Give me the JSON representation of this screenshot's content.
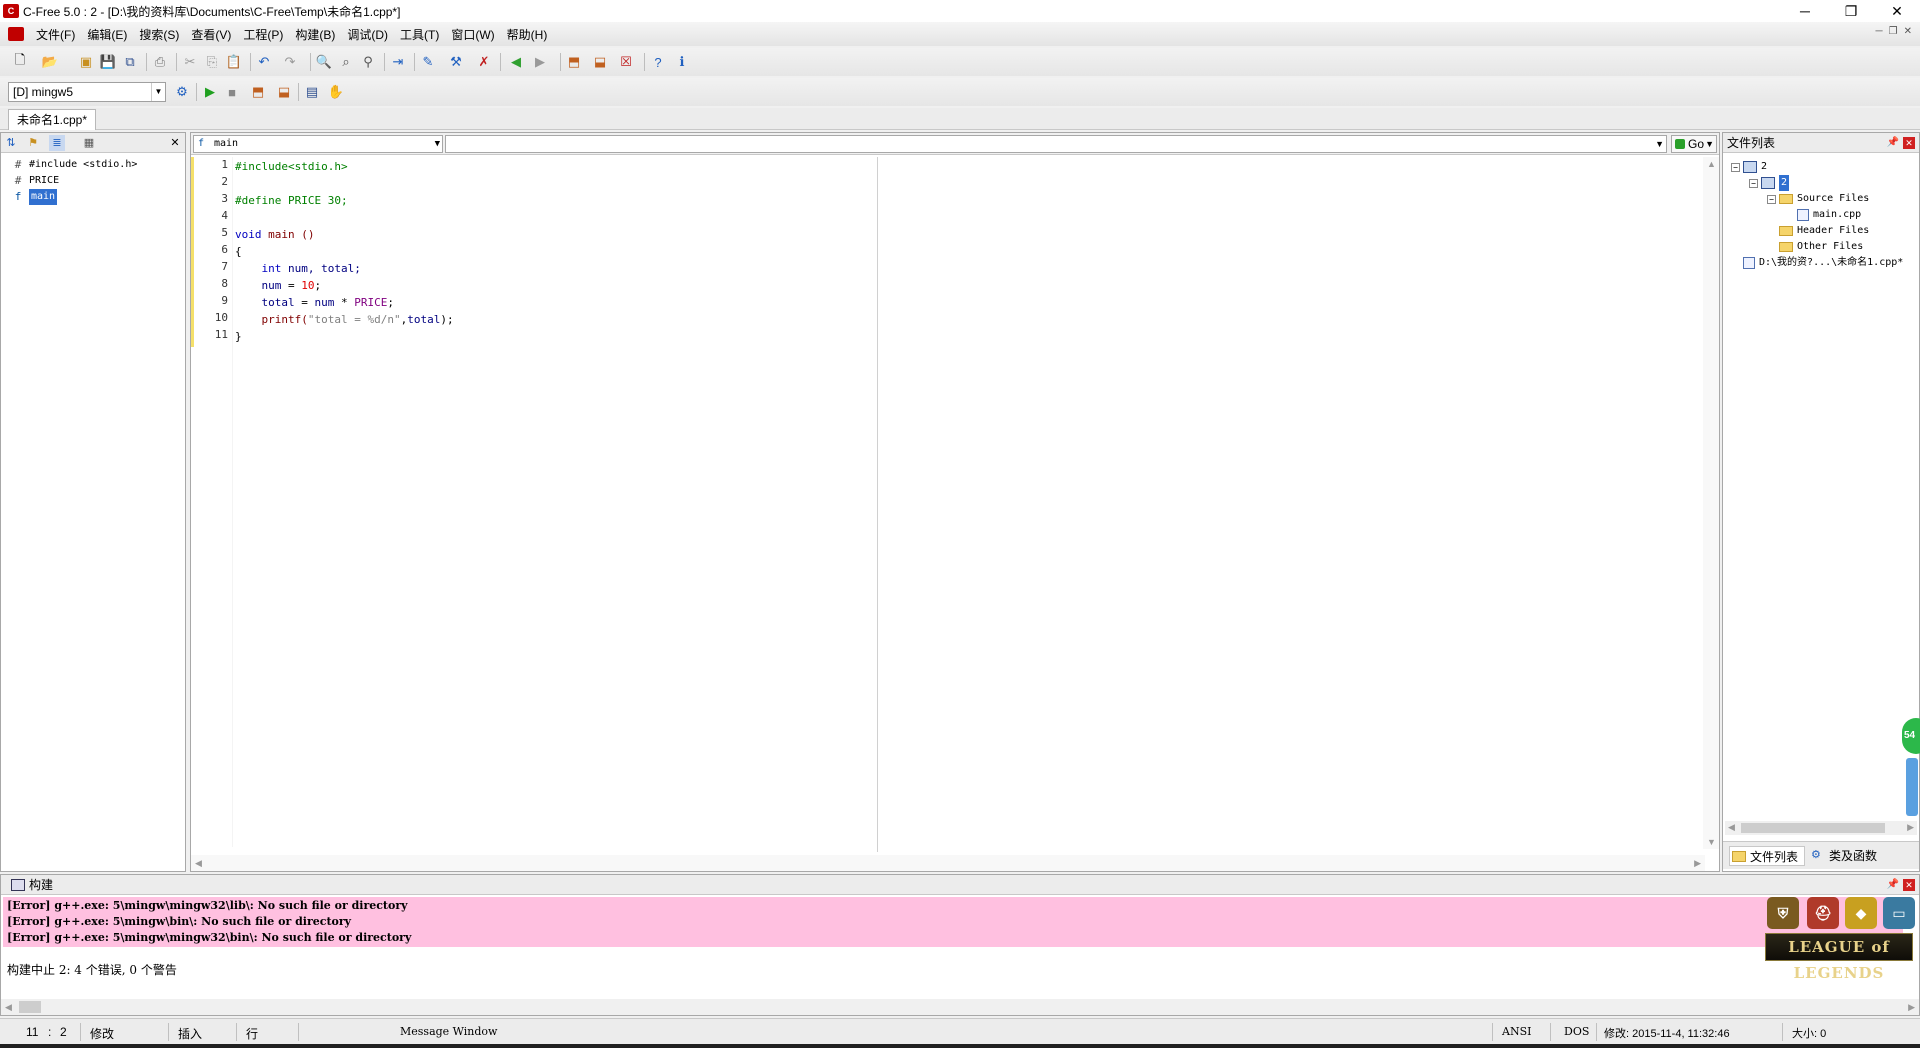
{
  "window": {
    "title": "C-Free 5.0 : 2 - [D:\\我的资料库\\Documents\\C-Free\\Temp\\未命名1.cpp*]",
    "app_icon": "cfree-app-icon",
    "controls": [
      "─",
      "❐",
      "✕"
    ]
  },
  "menu": {
    "items": [
      "文件(F)",
      "编辑(E)",
      "搜索(S)",
      "查看(V)",
      "工程(P)",
      "构建(B)",
      "调试(D)",
      "工具(T)",
      "窗口(W)",
      "帮助(H)"
    ]
  },
  "mdi_controls": [
    "─",
    "❐",
    "✕"
  ],
  "toolbar": {
    "compiler": "[D] mingw5",
    "icons": [
      "new-file-icon",
      "open-icon",
      "open-project-icon",
      "save-icon",
      "save-all-icon",
      "print-icon",
      "cut-icon",
      "copy-icon",
      "paste-icon",
      "undo-icon",
      "redo-icon",
      "find-icon",
      "find-replace-icon",
      "find-in-files-icon",
      "goto-icon",
      "compile-icon",
      "build-icon",
      "rebuild-icon",
      "back-icon",
      "forward-icon",
      "run-icon",
      "stop-icon",
      "debug-icon",
      "step-icon",
      "help-icon",
      "info-icon"
    ]
  },
  "tabs": {
    "active": "未命名1.cpp*"
  },
  "symbol_panel": {
    "items": [
      {
        "icon": "#",
        "label": "#include <stdio.h>"
      },
      {
        "icon": "#",
        "label": "PRICE"
      },
      {
        "icon": "f",
        "label": "main"
      }
    ]
  },
  "editor": {
    "function_combo": "main",
    "go_label": "Go",
    "line_numbers": [
      "1",
      "2",
      "3",
      "4",
      "5",
      "6",
      "7",
      "8",
      "9",
      "10",
      "11"
    ],
    "lines": [
      [
        {
          "t": "#include<stdio.h>",
          "c": "pp"
        }
      ],
      [],
      [
        {
          "t": "#define PRICE 30;",
          "c": "pp"
        }
      ],
      [],
      [
        {
          "t": "void",
          "c": "kw"
        },
        {
          "t": " main ()",
          "c": "fn"
        }
      ],
      [
        {
          "t": "{",
          "c": "dark"
        }
      ],
      [
        {
          "t": "    ",
          "c": "dark"
        },
        {
          "t": "int",
          "c": "kw"
        },
        {
          "t": " num, total;",
          "c": "id"
        }
      ],
      [
        {
          "t": "    num ",
          "c": "id"
        },
        {
          "t": "=",
          "c": "dark"
        },
        {
          "t": " ",
          "c": "dark"
        },
        {
          "t": "10",
          "c": "num"
        },
        {
          "t": ";",
          "c": "dark"
        }
      ],
      [
        {
          "t": "    total ",
          "c": "id"
        },
        {
          "t": "=",
          "c": "dark"
        },
        {
          "t": " num ",
          "c": "id"
        },
        {
          "t": "*",
          "c": "dark"
        },
        {
          "t": " ",
          "c": "dark"
        },
        {
          "t": "PRICE",
          "c": "mac"
        },
        {
          "t": ";",
          "c": "dark"
        }
      ],
      [
        {
          "t": "    printf(",
          "c": "fn"
        },
        {
          "t": "\"total = %d/n\"",
          "c": "str"
        },
        {
          "t": ",",
          "c": "dark"
        },
        {
          "t": "total",
          "c": "id"
        },
        {
          "t": ");",
          "c": "dark"
        }
      ],
      [
        {
          "t": "}",
          "c": "dark"
        }
      ]
    ]
  },
  "file_panel": {
    "title": "文件列表",
    "tree": [
      {
        "level": 0,
        "exp": "−",
        "icon": "proj",
        "label": "2",
        "hl": false
      },
      {
        "level": 1,
        "exp": "−",
        "icon": "proj",
        "label": "2",
        "hl": true
      },
      {
        "level": 2,
        "exp": "−",
        "icon": "folder",
        "label": "Source Files",
        "hl": false
      },
      {
        "level": 3,
        "exp": "",
        "icon": "doc",
        "label": "main.cpp",
        "hl": false
      },
      {
        "level": 2,
        "exp": "",
        "icon": "folder",
        "label": "Header Files",
        "hl": false
      },
      {
        "level": 2,
        "exp": "",
        "icon": "folder",
        "label": "Other Files",
        "hl": false
      },
      {
        "level": 0,
        "exp": "",
        "icon": "doc",
        "label": "D:\\我的资?...\\未命名1.cpp*",
        "hl": false
      }
    ],
    "tab_files": "文件列表",
    "tab_classes": "类及函数"
  },
  "build_panel": {
    "title": "构建",
    "errors": [
      "[Error] g++.exe: 5\\mingw\\mingw32\\lib\\: No such file or directory",
      "[Error] g++.exe: 5\\mingw\\bin\\: No such file or directory",
      "[Error] g++.exe: 5\\mingw\\mingw32\\bin\\: No such file or directory"
    ],
    "summary": "构建中止 2: 4 个错误, 0 个警告",
    "overlay_text": "LEAGUE of LEGENDS",
    "overlay_badge": "54"
  },
  "status": {
    "line": "11",
    "col": "2",
    "modified": "修改",
    "insert": "插入",
    "row": "行",
    "window": "Message Window",
    "encoding": "ANSI",
    "eol": "DOS",
    "modified_time": "修改: 2015-11-4, 11:32:46",
    "size": "大小: 0"
  }
}
